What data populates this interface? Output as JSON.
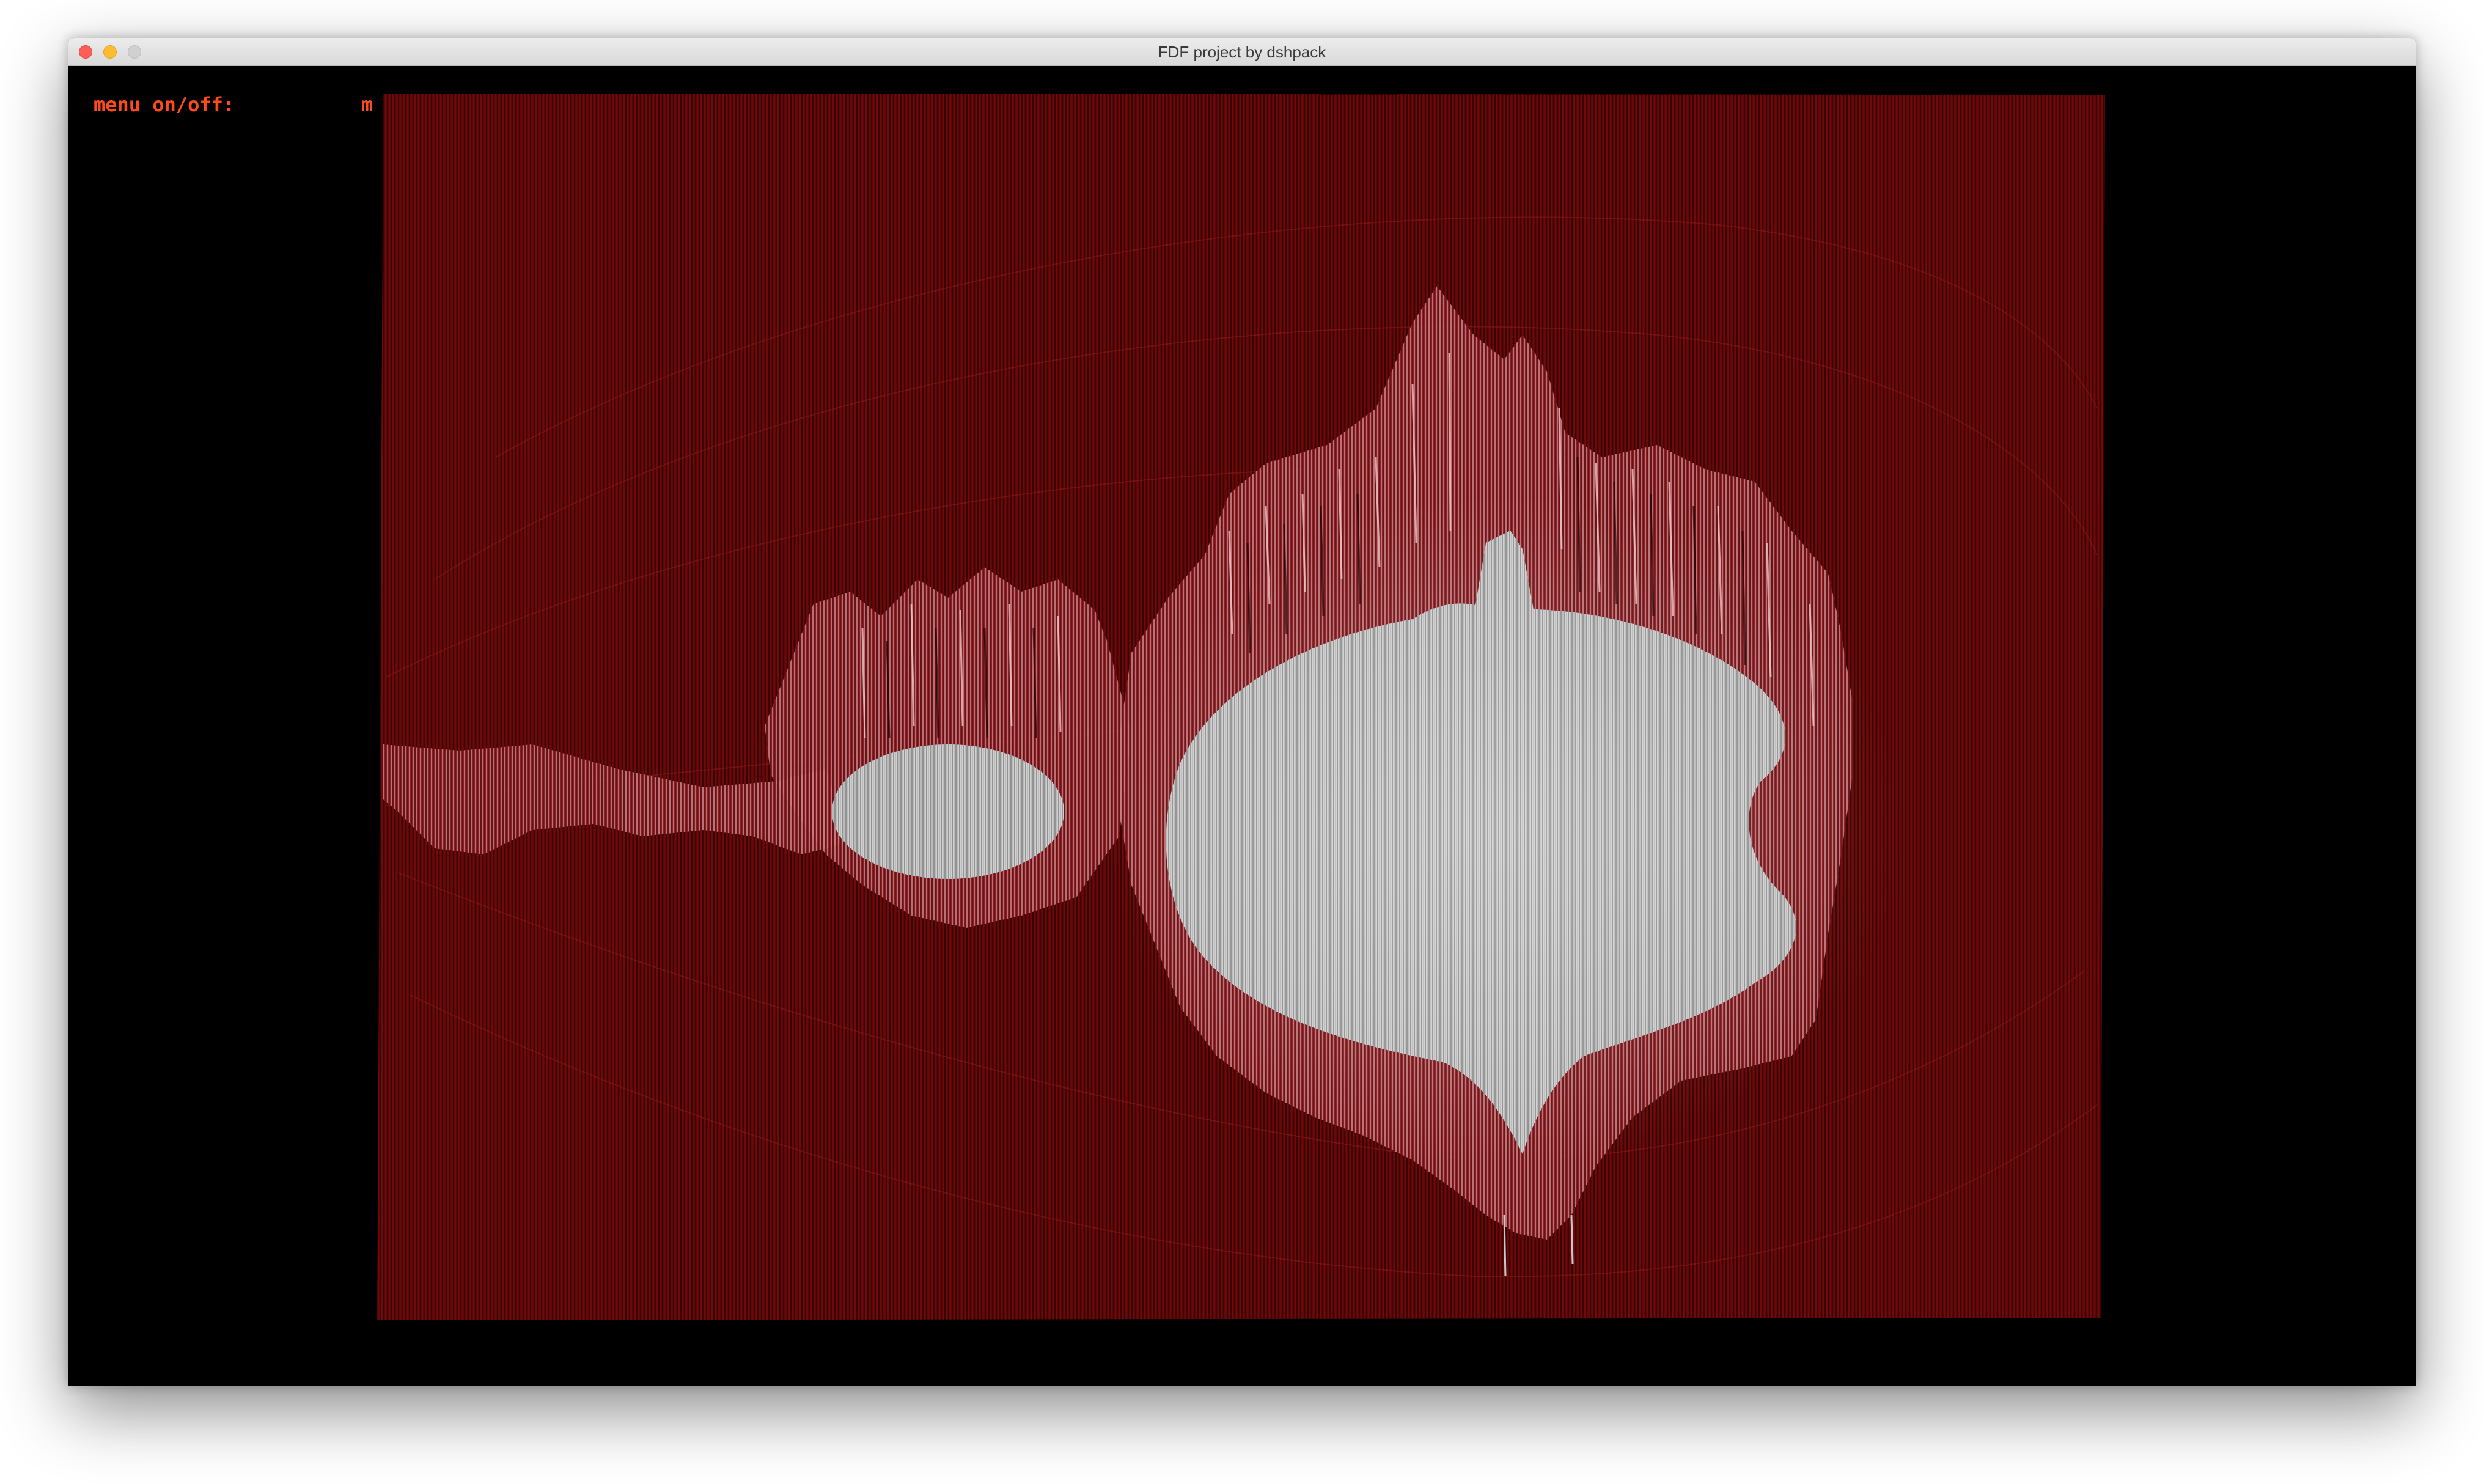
{
  "window": {
    "title": "FDF project by dshpack"
  },
  "menu_hint": {
    "label": "menu on/off:",
    "key": "m"
  },
  "render": {
    "background_color": "#000000",
    "surface_color": "#5e0606",
    "ridge_color": "#b7444a",
    "inner_color": "#c9c9c9",
    "text_color": "#ff4a1c"
  }
}
